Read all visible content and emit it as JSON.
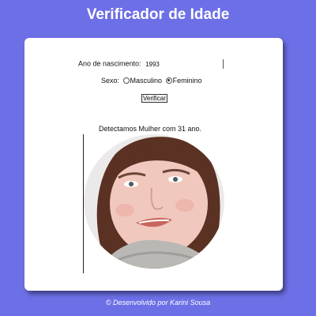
{
  "header": {
    "title": "Verificador de Idade"
  },
  "form": {
    "year_label": "Ano de nascimento:",
    "year_value": "1993",
    "sex_label": "Sexo:",
    "sex_options": [
      {
        "label": "Masculino",
        "checked": false
      },
      {
        "label": "Feminino",
        "checked": true
      }
    ],
    "verify_label": "Verificar"
  },
  "result": {
    "text": "Detectamos Mulher com 31 ano."
  },
  "footer": {
    "text": "© Desenvolvido por Karini Sousa"
  },
  "colors": {
    "background": "#6d6fe6",
    "card": "#ffffff"
  }
}
